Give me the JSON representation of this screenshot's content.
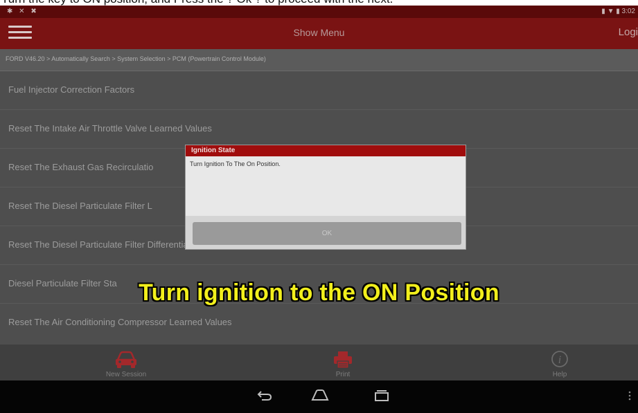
{
  "caption": "Turn the key to ON position, and Press the ? Ok ? to proceed with the next.",
  "status_bar": {
    "left_icons": "✱ ✕ ✖",
    "right_text": "▮ ▼ ▮ 3:02"
  },
  "app_bar": {
    "title": "Show Menu",
    "login_label": "Logi"
  },
  "breadcrumb": "FORD V46.20 > Automatically Search > System Selection > PCM (Powertrain Control Module)",
  "list": {
    "items": [
      {
        "label": "Fuel Injector Correction Factors"
      },
      {
        "label": "Reset The Intake Air Throttle Valve Learned Values"
      },
      {
        "label": "Reset The Exhaust Gas Recirculatio"
      },
      {
        "label": "Reset The Diesel Particulate Filter L"
      },
      {
        "label": "Reset The Diesel Particulate Filter Differential Pressure Sensor Learned Values"
      },
      {
        "label": "Diesel Particulate Filter Sta"
      },
      {
        "label": "Reset The Air Conditioning Compressor Learned Values"
      }
    ]
  },
  "dialog": {
    "title": "Ignition State",
    "message": "Turn Ignition To The On Position.",
    "ok_label": "OK"
  },
  "bottom_bar": {
    "new_session_label": "New Session",
    "print_label": "Print",
    "help_label": "Help"
  },
  "subtitle_overlay": "Turn ignition to the ON Position",
  "colors": {
    "app_bar": "#7a1313",
    "dialog_header": "#a00d0d",
    "subtitle": "#f2ef1c",
    "icon_red": "#a3282b"
  }
}
